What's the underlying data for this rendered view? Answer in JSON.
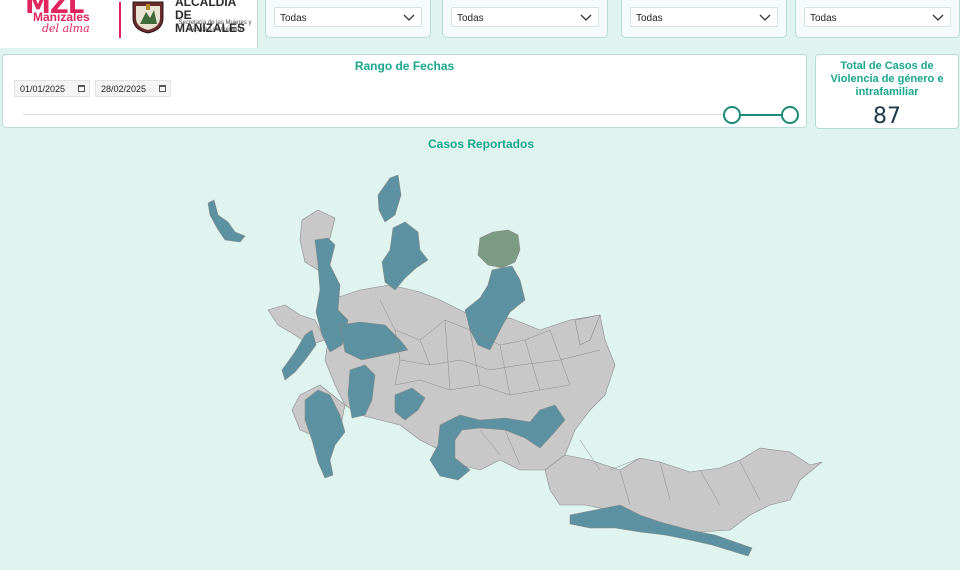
{
  "header": {
    "logo_mzl": "MZL",
    "logo_city": "Manizales",
    "logo_tagline": "del alma",
    "alcaldia_line1": "ALCALDÍA",
    "alcaldia_line2": "DE MANIZALES",
    "alcaldia_sub": "Secretaría de las Mujeres y Equidad de Género"
  },
  "filters": [
    {
      "value": "Todas"
    },
    {
      "value": "Todas"
    },
    {
      "value": "Todas"
    },
    {
      "value": "Todas"
    }
  ],
  "date_range": {
    "title": "Rango de Fechas",
    "start": "01/01/2025",
    "end": "28/02/2025"
  },
  "total": {
    "label": "Total de Casos de Violencia de género e intrafamiliar",
    "value": "87"
  },
  "map": {
    "title": "Casos Reportados"
  },
  "colors": {
    "accent": "#1aa68e",
    "highlight_region": "#5b91a0",
    "other_region": "#c8c8c8",
    "special_region": "#7d9b84",
    "background": "#dff3ef"
  }
}
